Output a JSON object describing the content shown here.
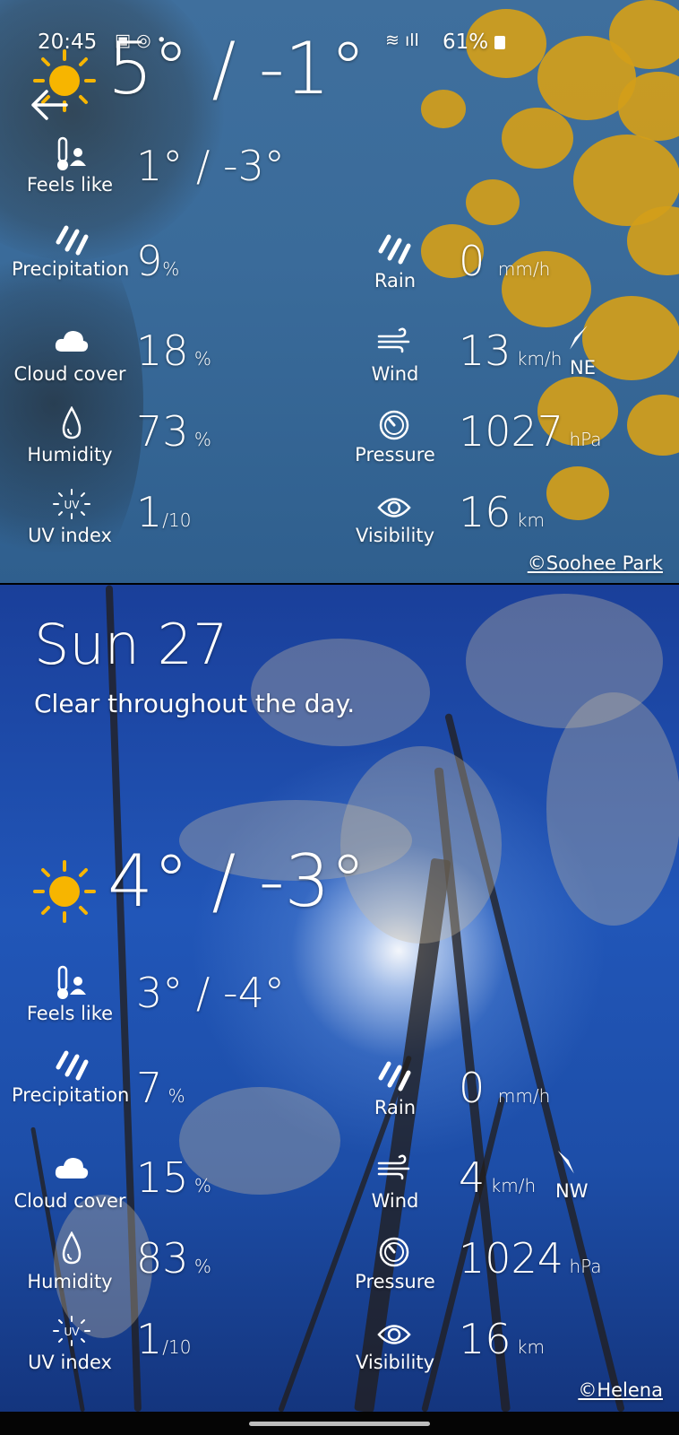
{
  "status_bar": {
    "time": "20:45",
    "battery": "61%"
  },
  "today": {
    "temp_range": "5° / -1°",
    "feels_like": "1°  /  -3°",
    "precip_value": "9",
    "rain_value": "0",
    "cloud_value": "18",
    "wind_value": "13",
    "wind_dir": "NE",
    "humidity_value": "73",
    "pressure_value": "1027",
    "uv_value": "1",
    "visibility_value": "16",
    "credit": "©Soohee Park"
  },
  "sunday": {
    "date": "Sun 27",
    "summary": "Clear throughout the day.",
    "temp_range": "4° / -3°",
    "feels_like": "3°  /  -4°",
    "precip_value": "7",
    "rain_value": "0",
    "cloud_value": "15",
    "wind_value": "4",
    "wind_dir": "NW",
    "humidity_value": "83",
    "pressure_value": "1024",
    "uv_value": "1",
    "visibility_value": "16",
    "credit": "©Helena"
  },
  "labels": {
    "feels_like": "Feels like",
    "precipitation": "Precipitation",
    "rain": "Rain",
    "cloud_cover": "Cloud cover",
    "wind": "Wind",
    "humidity": "Humidity",
    "pressure": "Pressure",
    "uv_index": "UV index",
    "visibility": "Visibility"
  },
  "units": {
    "percent": "%",
    "rain": "mm/h",
    "wind": "km/h",
    "pressure": "hPa",
    "uv": "/10",
    "visibility": "km"
  },
  "icons": {
    "back": "arrow-left-icon",
    "sun": "sun-icon",
    "feels_like": "thermometer-person-icon",
    "precipitation": "rain-streaks-icon",
    "cloud": "cloud-icon",
    "wind": "wind-icon",
    "humidity": "water-drop-icon",
    "pressure": "gauge-icon",
    "uv": "uv-icon",
    "visibility": "eye-icon",
    "wind_direction": "navigation-arrow-icon"
  },
  "colors": {
    "sun": "#f7b500",
    "foliage": "#d39e1a"
  }
}
